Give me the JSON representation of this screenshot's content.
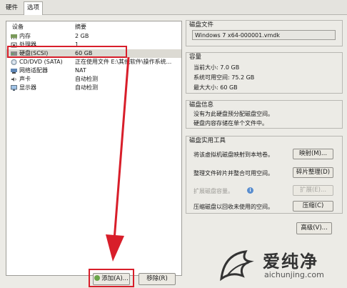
{
  "tabs": [
    {
      "label": "硬件",
      "active": false
    },
    {
      "label": "选项",
      "active": true
    }
  ],
  "device_list": {
    "headers": {
      "device": "设备",
      "summary": "摘要"
    },
    "rows": [
      {
        "device": "内存",
        "summary": "2 GB",
        "icon": "memory-icon"
      },
      {
        "device": "处理器",
        "summary": "1",
        "icon": "processor-icon"
      },
      {
        "device": "硬盘(SCSI)",
        "summary": "60 GB",
        "icon": "hard-disk-icon",
        "selected": true
      },
      {
        "device": "CD/DVD (SATA)",
        "summary": "正在使用文件 E:\\其他软件\\操作系统...",
        "icon": "cd-dvd-icon"
      },
      {
        "device": "网络适配器",
        "summary": "NAT",
        "icon": "network-adapter-icon"
      },
      {
        "device": "声卡",
        "summary": "自动检测",
        "icon": "sound-card-icon"
      },
      {
        "device": "显示器",
        "summary": "自动检测",
        "icon": "display-icon"
      }
    ]
  },
  "buttons": {
    "add": "添加(A)...",
    "remove": "移除(R)",
    "advanced": "高级(V)..."
  },
  "disk_file": {
    "title": "磁盘文件",
    "value": "Windows 7 x64-000001.vmdk"
  },
  "capacity": {
    "title": "容量",
    "current": "当前大小: 7.0 GB",
    "available": "系统可用空间: 75.2 GB",
    "max": "最大大小: 60 GB"
  },
  "disk_info": {
    "title": "磁盘信息",
    "line1": "没有为此硬盘预分配磁盘空间。",
    "line2": "硬盘内容存储在单个文件中。"
  },
  "disk_utility": {
    "title": "磁盘实用工具",
    "rows": [
      {
        "label": "将该虚拟机磁盘映射到本地卷。",
        "button": "映射(M)...",
        "enabled": true
      },
      {
        "label": "整理文件碎片并整合可用空间。",
        "button": "碎片整理(D)",
        "enabled": true
      },
      {
        "label": "扩展磁盘容量。",
        "button": "扩展(E)...",
        "enabled": false
      },
      {
        "label": "压缩磁盘以回收未使用的空间。",
        "button": "压缩(C)",
        "enabled": true
      }
    ]
  },
  "watermark": {
    "name": "爱纯净",
    "url": "aichunjing.com"
  },
  "colors": {
    "highlight": "#d81e2a",
    "selection": "#dcdad3",
    "panel": "#ecebe6"
  }
}
